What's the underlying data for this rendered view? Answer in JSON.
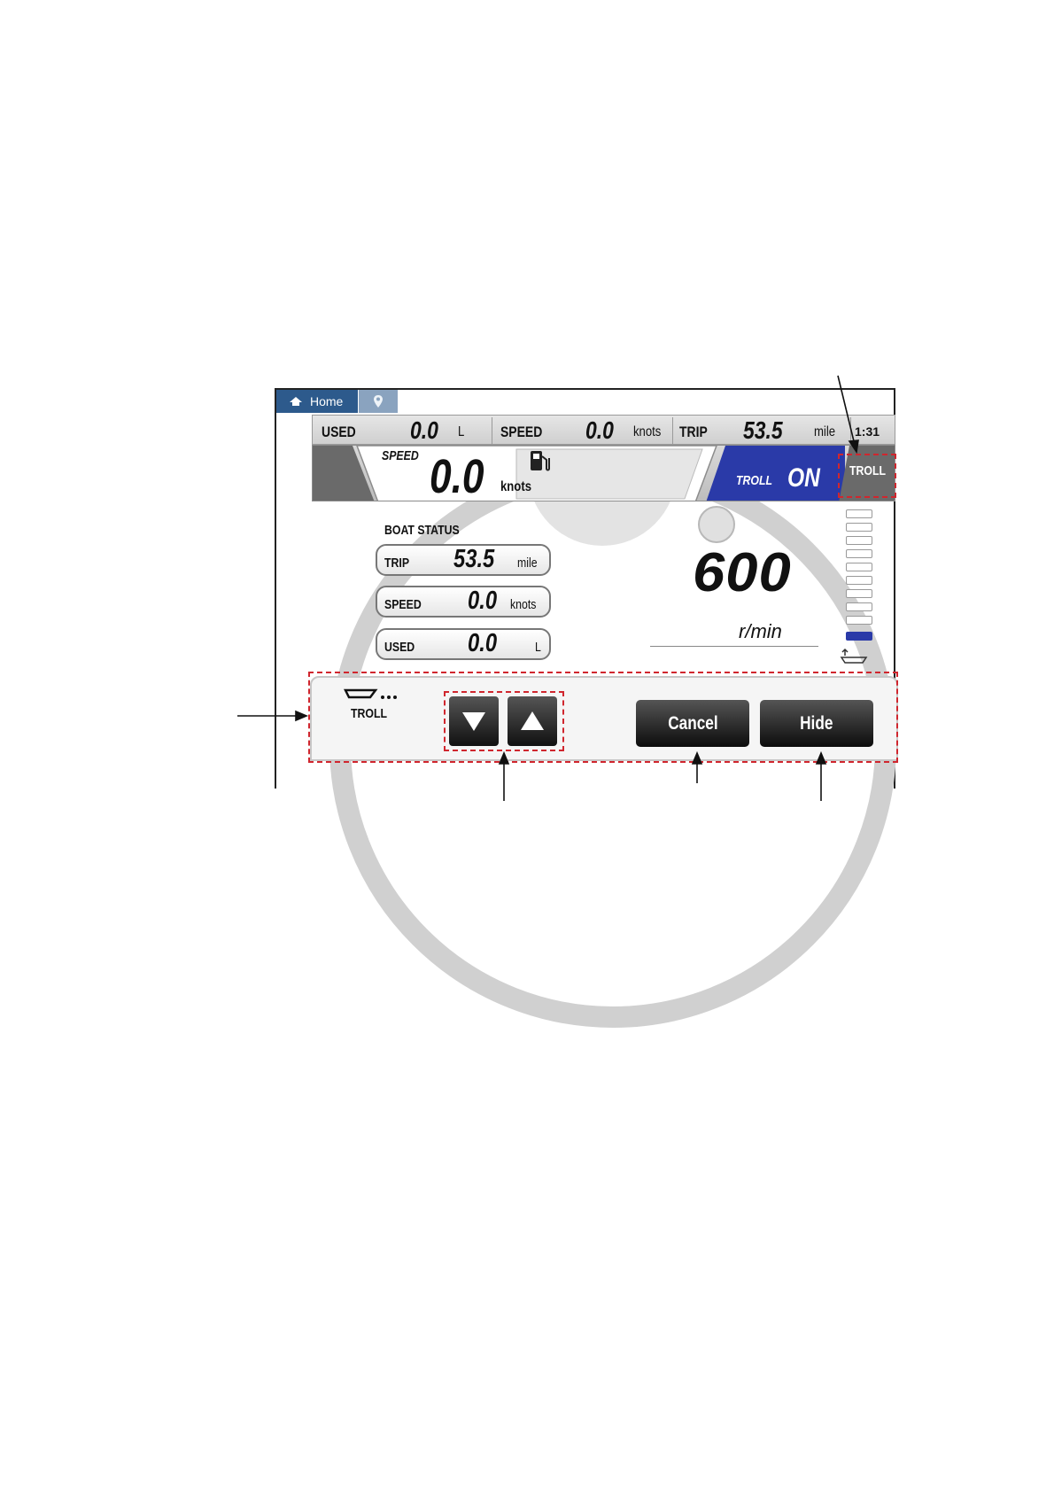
{
  "tabs": {
    "home_label": "Home"
  },
  "top_bar": {
    "used_label": "USED",
    "used_value": "0.0",
    "used_unit": "L",
    "speed_label": "SPEED",
    "speed_value": "0.0",
    "speed_unit": "knots",
    "trip_label": "TRIP",
    "trip_value": "53.5",
    "trip_unit": "mile",
    "clock": "1:31"
  },
  "second_bar": {
    "speed_label": "SPEED",
    "speed_value": "0.0",
    "speed_unit": "knots",
    "troll_label": "TROLL",
    "troll_state": "ON",
    "troll_button": "TROLL"
  },
  "boat_status": {
    "title": "BOAT STATUS",
    "rows": [
      {
        "label": "TRIP",
        "value": "53.5",
        "unit": "mile"
      },
      {
        "label": "SPEED",
        "value": "0.0",
        "unit": "knots"
      },
      {
        "label": "USED",
        "value": "0.0",
        "unit": "L"
      }
    ]
  },
  "tachometer": {
    "rpm_value": "600",
    "rpm_unit": "r/min"
  },
  "troll_panel": {
    "label": "TROLL",
    "cancel_label": "Cancel",
    "hide_label": "Hide"
  },
  "icons": [
    "home-icon",
    "location-pin-icon",
    "fuel-pump-icon",
    "boat-icon",
    "down-arrow-icon",
    "up-arrow-icon"
  ],
  "colors": {
    "troll_blue": "#2a3aa8",
    "tab_blue": "#2d5a8c",
    "callout_red": "#d0262e"
  }
}
